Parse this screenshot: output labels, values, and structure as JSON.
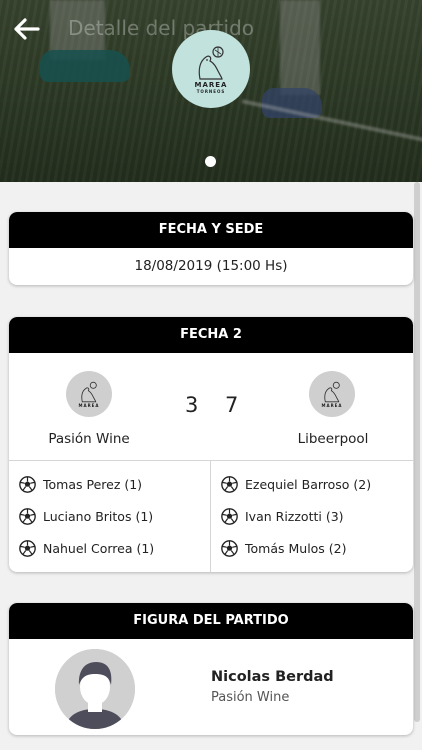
{
  "header": {
    "title": "Detalle del partido",
    "logo_text": "MAREA",
    "logo_subtext": "TORNEOS"
  },
  "venue": {
    "heading": "FECHA Y SEDE",
    "datetime": "18/08/2019 (15:00 Hs)"
  },
  "match": {
    "heading": "FECHA 2",
    "home": {
      "name": "Pasión Wine",
      "score": "3"
    },
    "away": {
      "name": "Libeerpool",
      "score": "7"
    },
    "home_scorers": [
      "Tomas Perez (1)",
      "Luciano Britos (1)",
      "Nahuel Correa (1)"
    ],
    "away_scorers": [
      "Ezequiel Barroso (2)",
      "Ivan Rizzotti (3)",
      "Tomás Mulos (2)"
    ]
  },
  "figure": {
    "heading": "FIGURA DEL PARTIDO",
    "name": "Nicolas Berdad",
    "team": "Pasión Wine"
  }
}
